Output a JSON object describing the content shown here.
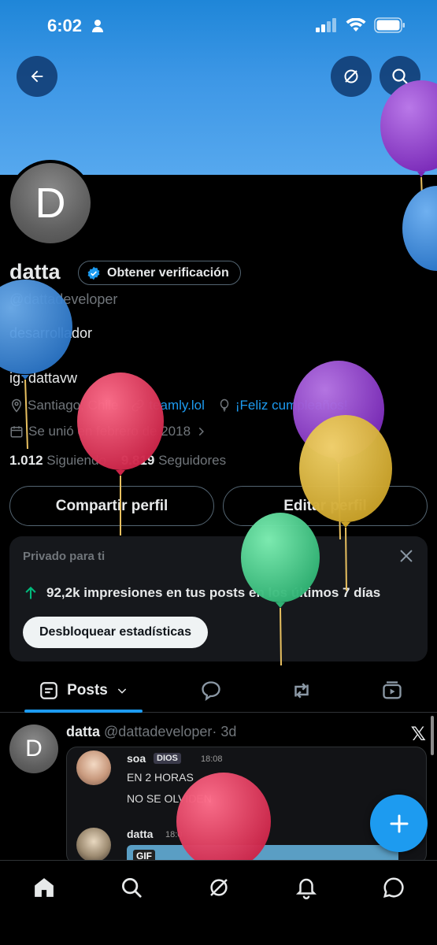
{
  "status_bar": {
    "time": "6:02"
  },
  "profile": {
    "name": "datta",
    "avatar_letter": "D",
    "verify_label": "Obtener verificación",
    "handle": "@dattadeveloper",
    "bio": "desarrollador",
    "instagram": "ig: dattavw",
    "location": "Santiago, Chile",
    "website": "teamly.lol",
    "birthday": "¡Feliz cumpleaños!",
    "joined": "Se unió en febrero de 2018",
    "following_count": "1.012",
    "following_label": "Siguiendo",
    "followers_count": "9.819",
    "followers_label": "Seguidores"
  },
  "actions": {
    "share_profile": "Compartir perfil",
    "edit_profile": "Editar perfil"
  },
  "private_card": {
    "title": "Privado para ti",
    "impressions_text": "92,2k impresiones en tus posts en los últimos 7 días",
    "unlock_label": "Desbloquear estadísticas"
  },
  "tabs": {
    "posts_label": "Posts"
  },
  "post": {
    "author": "datta",
    "handle": "@dattadeveloper",
    "time": "· 3d",
    "x_logo": "𝕏",
    "chat": [
      {
        "name": "soa",
        "badge": "DIOS",
        "time": "18:08",
        "lines": [
          "EN 2 HORAS",
          "NO SE OLVIDEN"
        ]
      },
      {
        "name": "datta",
        "time": "18:0",
        "gif_label": "GIF"
      }
    ]
  },
  "colors": {
    "accent": "#1d9bf0",
    "background": "#000000",
    "card": "#16181c",
    "muted": "#71767b"
  }
}
